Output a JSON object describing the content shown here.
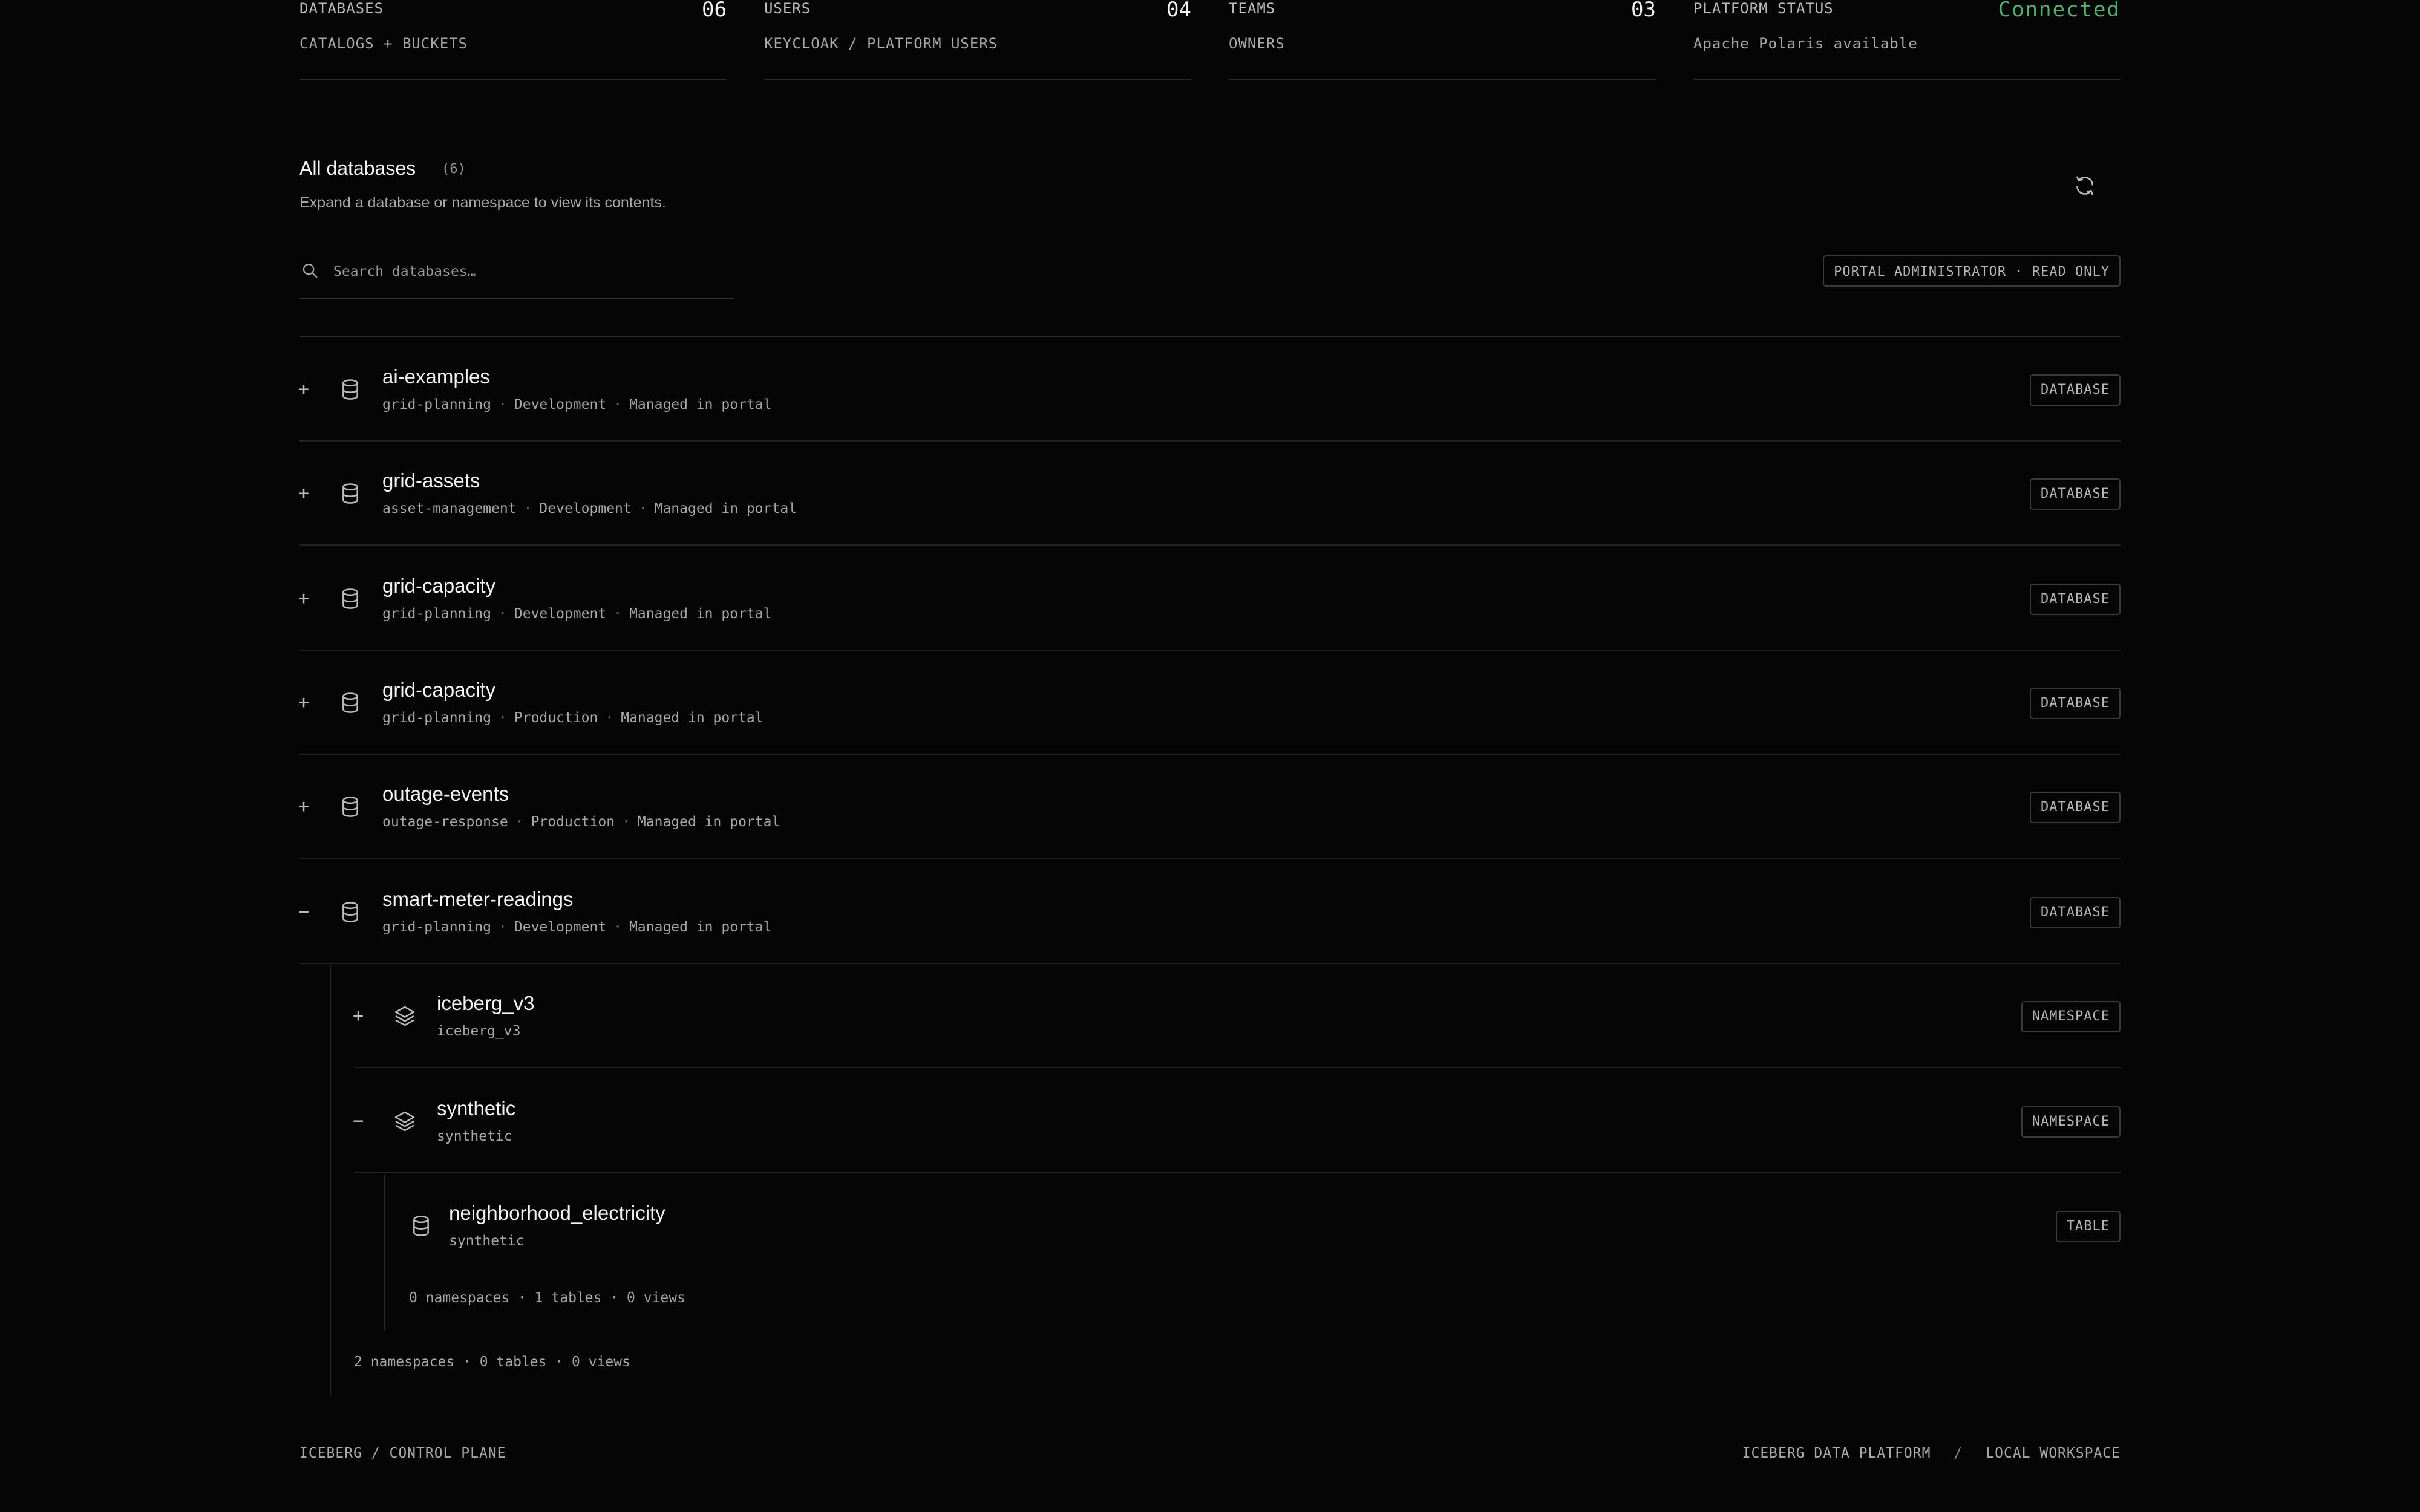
{
  "stats": [
    {
      "label": "DATABASES",
      "value": "06",
      "sub": "CATALOGS + BUCKETS"
    },
    {
      "label": "USERS",
      "value": "04",
      "sub": "KEYCLOAK / PLATFORM USERS"
    },
    {
      "label": "TEAMS",
      "value": "03",
      "sub": "OWNERS"
    },
    {
      "label": "PLATFORM STATUS",
      "value": "Connected",
      "sub": "Apache Polaris available"
    }
  ],
  "section": {
    "title": "All databases",
    "count": "(6)",
    "description": "Expand a database or namespace to view its contents.",
    "refresh_icon": "refresh-icon"
  },
  "search": {
    "placeholder": "Search databases…",
    "value": ""
  },
  "role_badge": "PORTAL ADMINISTRATOR · READ ONLY",
  "databases": [
    {
      "toggle": "+",
      "name": "ai-examples",
      "team": "grid-planning",
      "env": "Development",
      "managed": "Managed in portal",
      "badge": "DATABASE"
    },
    {
      "toggle": "+",
      "name": "grid-assets",
      "team": "asset-management",
      "env": "Development",
      "managed": "Managed in portal",
      "badge": "DATABASE"
    },
    {
      "toggle": "+",
      "name": "grid-capacity",
      "team": "grid-planning",
      "env": "Development",
      "managed": "Managed in portal",
      "badge": "DATABASE"
    },
    {
      "toggle": "+",
      "name": "grid-capacity",
      "team": "grid-planning",
      "env": "Production",
      "managed": "Managed in portal",
      "badge": "DATABASE"
    },
    {
      "toggle": "+",
      "name": "outage-events",
      "team": "outage-response",
      "env": "Production",
      "managed": "Managed in portal",
      "badge": "DATABASE"
    },
    {
      "toggle": "−",
      "name": "smart-meter-readings",
      "team": "grid-planning",
      "env": "Development",
      "managed": "Managed in portal",
      "badge": "DATABASE"
    }
  ],
  "namespaces": [
    {
      "toggle": "+",
      "name": "iceberg_v3",
      "path": "iceberg_v3",
      "badge": "NAMESPACE"
    },
    {
      "toggle": "−",
      "name": "synthetic",
      "path": "synthetic",
      "badge": "NAMESPACE"
    }
  ],
  "tables": [
    {
      "name": "neighborhood_electricity",
      "path": "synthetic",
      "badge": "TABLE"
    }
  ],
  "namespace_summary": "0 namespaces · 1 tables · 0 views",
  "database_summary": "2 namespaces · 0 tables · 0 views",
  "footer": {
    "left": "ICEBERG / CONTROL PLANE",
    "right_a": "ICEBERG DATA PLATFORM",
    "sep": "/",
    "right_b": "LOCAL WORKSPACE"
  },
  "colors": {
    "background": "#050505",
    "connected": "#4caf6a",
    "border": "#2a2a2a"
  }
}
